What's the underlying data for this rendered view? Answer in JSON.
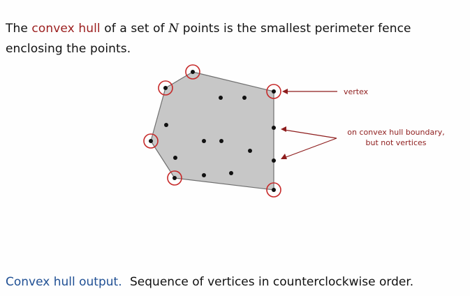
{
  "intro": {
    "before_term": "The ",
    "term": "convex hull",
    "middle": " of a set of ",
    "symbol": "N",
    "after_symbol": " points is the smallest perimeter fence enclosing the points."
  },
  "labels": {
    "vertex": "vertex",
    "boundary_line_1": "on convex hull boundary,",
    "boundary_line_2": "but not vertices"
  },
  "footer": {
    "heading": "Convex hull output.",
    "text": "Sequence of vertices in counterclockwise order."
  },
  "colors": {
    "term": "#9b1e1e",
    "heading": "#1f4f93",
    "hull_fill": "#c7c7c7",
    "vertex_ring": "#c62828",
    "annotation": "#8e1d1d"
  }
}
